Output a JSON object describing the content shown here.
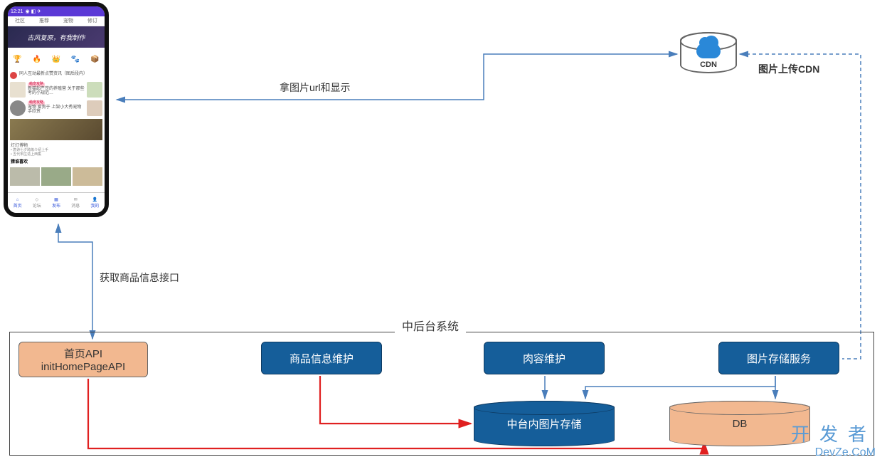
{
  "phone": {
    "time": "12:21",
    "status_icons": "◉ ◧ ✈",
    "tabs": [
      "社区",
      "推荐",
      "宠物",
      "修订"
    ],
    "hero_text": "古风复原，有我制作",
    "icon_row_emojis": [
      "🏆",
      "🔥",
      "👑",
      "🐾",
      "📦"
    ],
    "feed_avatar_text": "同人互动最新点赞资讯（图后段内）",
    "feed_tag": "萌宠攻略",
    "feed_snippet_1": "新猫超严苛的养殖营 关于那些考的小规范…",
    "feed_snippet_2": "宠物 爱狗于 上架小大秀宠物手欣赏"
  },
  "phone_banner_title": "灯灯博物",
  "phone_bullets": [
    "唐诗七夕跨炼介绍上手",
    "五代宋庄造上西集"
  ],
  "phone_bottom_label": "猜谁喜欢",
  "phone_nav": [
    "首页",
    "论坛",
    "发布",
    "消息",
    "我的"
  ],
  "cdn_label": "CDN",
  "labels": {
    "fetch_image_url": "拿图片url和显示",
    "upload_cdn": "图片上传CDN",
    "fetch_product_api": "获取商品信息接口",
    "backend_title": "中后台系统"
  },
  "boxes": {
    "api_line1": "首页API",
    "api_line2": "initHomePageAPI",
    "product": "商品信息维护",
    "content": "肉容维护",
    "image_service": "图片存储服务",
    "mid_storage": "中台内图片存储",
    "db": "DB"
  },
  "watermark": {
    "chinese": "开发者",
    "url": "DevZe.CoM"
  }
}
